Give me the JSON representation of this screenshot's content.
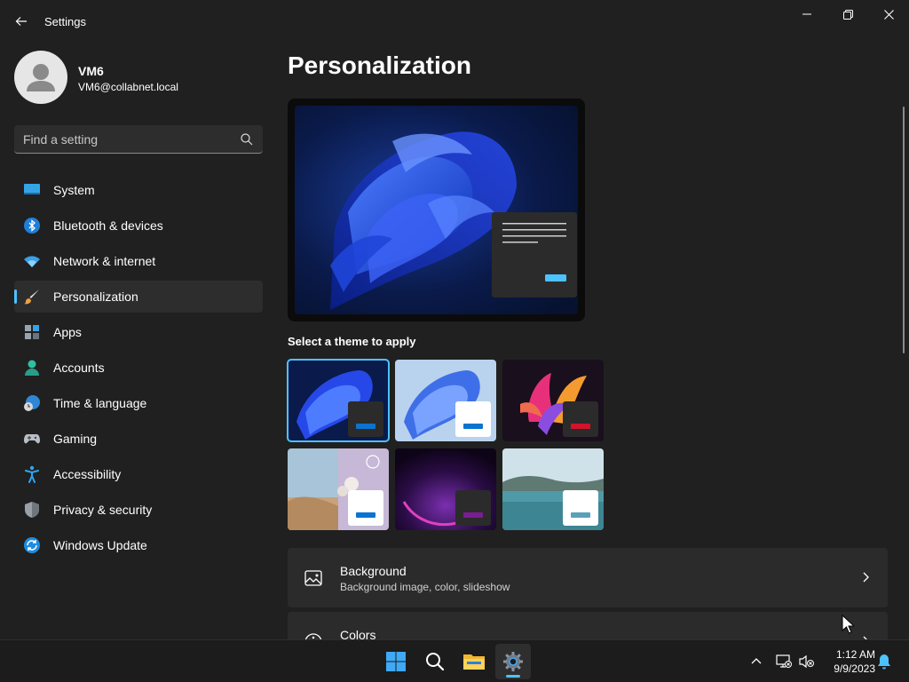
{
  "app": {
    "title": "Settings"
  },
  "user": {
    "name": "VM6",
    "email": "VM6@collabnet.local"
  },
  "search": {
    "placeholder": "Find a setting",
    "value": ""
  },
  "nav": {
    "items": [
      {
        "label": "System",
        "icon": "monitor-icon"
      },
      {
        "label": "Bluetooth & devices",
        "icon": "bluetooth-icon"
      },
      {
        "label": "Network & internet",
        "icon": "wifi-icon"
      },
      {
        "label": "Personalization",
        "icon": "brush-icon",
        "selected": true
      },
      {
        "label": "Apps",
        "icon": "apps-icon"
      },
      {
        "label": "Accounts",
        "icon": "accounts-icon"
      },
      {
        "label": "Time & language",
        "icon": "globe-clock-icon"
      },
      {
        "label": "Gaming",
        "icon": "gamepad-icon"
      },
      {
        "label": "Accessibility",
        "icon": "accessibility-icon"
      },
      {
        "label": "Privacy & security",
        "icon": "shield-icon"
      },
      {
        "label": "Windows Update",
        "icon": "update-icon"
      }
    ]
  },
  "main": {
    "title": "Personalization",
    "themes_label": "Select a theme to apply",
    "themes": [
      {
        "name": "windows-dark",
        "selected": true,
        "accent": "#0a74d0"
      },
      {
        "name": "windows-light",
        "accent": "#0a74d0"
      },
      {
        "name": "glow",
        "accent": "#d3132a"
      },
      {
        "name": "captured-motion",
        "accent": "#0a74d0"
      },
      {
        "name": "flow",
        "accent": "#7a1d92"
      },
      {
        "name": "sunrise",
        "accent": "#5aa0b8"
      }
    ],
    "cards": [
      {
        "title": "Background",
        "subtitle": "Background image, color, slideshow",
        "icon": "image-icon"
      },
      {
        "title": "Colors",
        "subtitle": "",
        "icon": "palette-icon"
      }
    ]
  },
  "taskbar": {
    "apps": [
      "start-icon",
      "search-icon",
      "file-explorer-icon",
      "settings-icon"
    ],
    "time": "1:12 AM",
    "date": "9/9/2023"
  },
  "colors": {
    "accent": "#4cc2ff",
    "background": "#202020",
    "card": "#2b2b2b"
  }
}
